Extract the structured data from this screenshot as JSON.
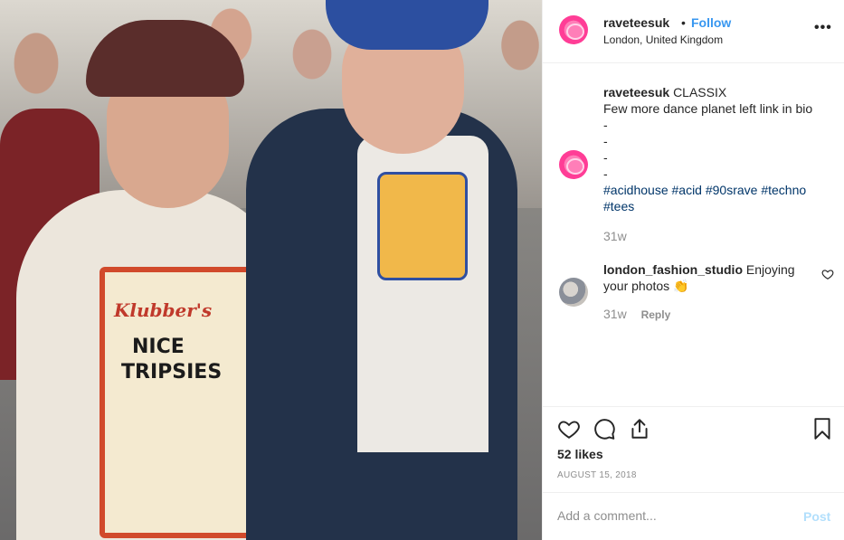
{
  "header": {
    "username": "raveteesuk",
    "separator": "•",
    "follow_label": "Follow",
    "location": "London, United Kingdom",
    "more_label": "•••"
  },
  "photo": {
    "tee_left_line1": "Klubber's",
    "tee_left_line2": "NICE",
    "tee_left_line3": "TRIPSIES"
  },
  "caption": {
    "username": "raveteesuk",
    "text": "CLASSIX",
    "line2": "Few more dance planet left link in bio",
    "dashes": [
      "-",
      "-",
      "-",
      "-"
    ],
    "hashtags_line1": "#acidhouse #acid #90srave #techno",
    "hashtags_line2": "#tees",
    "time": "31w"
  },
  "comment": {
    "username": "london_fashion_studio",
    "text": "Enjoying your photos",
    "emoji": "👏",
    "time": "31w",
    "reply_label": "Reply"
  },
  "actions": {
    "likes": "52 likes",
    "date": "AUGUST 15, 2018"
  },
  "add_comment": {
    "placeholder": "Add a comment...",
    "post_label": "Post"
  },
  "colors": {
    "link_blue": "#3897f0",
    "hashtag": "#003569",
    "muted": "#8e8e8e",
    "post_disabled": "#b2dffc"
  }
}
